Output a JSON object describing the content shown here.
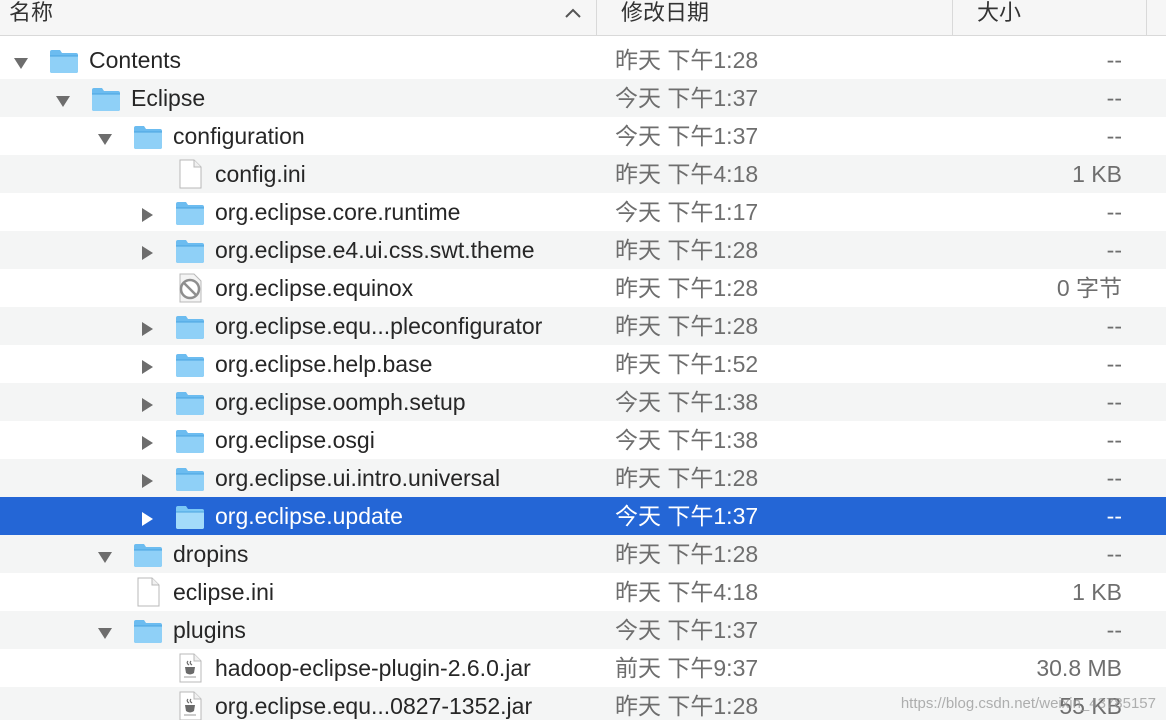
{
  "header": {
    "name_label": "名称",
    "date_label": "修改日期",
    "size_label": "大小"
  },
  "rows": [
    {
      "name": "Contents",
      "date": "昨天 下午1:28",
      "size": "--",
      "level": 0,
      "type": "folder",
      "expanded": true
    },
    {
      "name": "Eclipse",
      "date": "今天 下午1:37",
      "size": "--",
      "level": 1,
      "type": "folder",
      "expanded": true
    },
    {
      "name": "configuration",
      "date": "今天 下午1:37",
      "size": "--",
      "level": 2,
      "type": "folder",
      "expanded": true
    },
    {
      "name": "config.ini",
      "date": "昨天 下午4:18",
      "size": "1 KB",
      "level": 3,
      "type": "file"
    },
    {
      "name": "org.eclipse.core.runtime",
      "date": "今天 下午1:17",
      "size": "--",
      "level": 3,
      "type": "folder",
      "expanded": false
    },
    {
      "name": "org.eclipse.e4.ui.css.swt.theme",
      "date": "昨天 下午1:28",
      "size": "--",
      "level": 3,
      "type": "folder",
      "expanded": false
    },
    {
      "name": "org.eclipse.equinox",
      "date": "昨天 下午1:28",
      "size": "0 字节",
      "level": 3,
      "type": "prohibited"
    },
    {
      "name": "org.eclipse.equ...pleconfigurator",
      "date": "昨天 下午1:28",
      "size": "--",
      "level": 3,
      "type": "folder",
      "expanded": false
    },
    {
      "name": "org.eclipse.help.base",
      "date": "昨天 下午1:52",
      "size": "--",
      "level": 3,
      "type": "folder",
      "expanded": false
    },
    {
      "name": "org.eclipse.oomph.setup",
      "date": "今天 下午1:38",
      "size": "--",
      "level": 3,
      "type": "folder",
      "expanded": false
    },
    {
      "name": "org.eclipse.osgi",
      "date": "今天 下午1:38",
      "size": "--",
      "level": 3,
      "type": "folder",
      "expanded": false
    },
    {
      "name": "org.eclipse.ui.intro.universal",
      "date": "昨天 下午1:28",
      "size": "--",
      "level": 3,
      "type": "folder",
      "expanded": false
    },
    {
      "name": "org.eclipse.update",
      "date": "今天 下午1:37",
      "size": "--",
      "level": 3,
      "type": "folder",
      "expanded": false,
      "selected": true
    },
    {
      "name": "dropins",
      "date": "昨天 下午1:28",
      "size": "--",
      "level": 2,
      "type": "folder",
      "expanded": true
    },
    {
      "name": "eclipse.ini",
      "date": "昨天 下午4:18",
      "size": "1 KB",
      "level": 2,
      "type": "file"
    },
    {
      "name": "plugins",
      "date": "今天 下午1:37",
      "size": "--",
      "level": 2,
      "type": "folder",
      "expanded": true
    },
    {
      "name": "hadoop-eclipse-plugin-2.6.0.jar",
      "date": "前天 下午9:37",
      "size": "30.8 MB",
      "level": 3,
      "type": "jar"
    },
    {
      "name": "org.eclipse.equ...0827-1352.jar",
      "date": "昨天 下午1:28",
      "size": "55 KB",
      "level": 3,
      "type": "jar"
    }
  ],
  "watermark": "https://blog.csdn.net/weixin_43785157",
  "colors": {
    "selection": "#2466d6",
    "folder": "#6cbcf0",
    "alt_row": "#f4f5f5"
  }
}
